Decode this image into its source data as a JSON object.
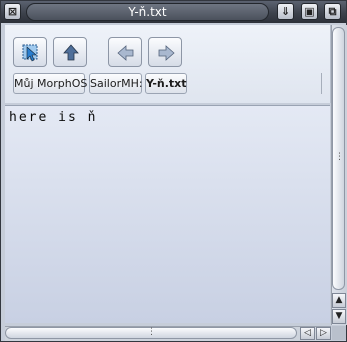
{
  "window": {
    "title": "Y-ň.txt"
  },
  "titlebar": {
    "close_glyph": "⊠",
    "icon_a": "⇓",
    "icon_b": "▣",
    "icon_c": "⧉"
  },
  "breadcrumb": {
    "items": [
      {
        "label": "Můj MorphOS"
      },
      {
        "label": "SailorMH:"
      },
      {
        "label": "Y-ň.txt"
      }
    ]
  },
  "content": {
    "text": "here is ň"
  },
  "scrollbars": {
    "up": "▲",
    "down": "▼",
    "left": "◁",
    "right": "▷",
    "grip_v": "⋮",
    "grip_h": "⋮"
  }
}
